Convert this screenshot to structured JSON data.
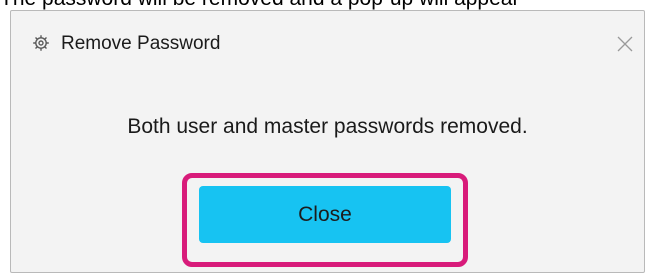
{
  "caption": {
    "text": "The password will be removed and a pop-up will appear"
  },
  "dialog": {
    "title": "Remove Password",
    "app_icon": "gear-app-icon",
    "close_icon": "close-icon",
    "message": "Both user and master passwords removed.",
    "close_button_label": "Close"
  },
  "colors": {
    "button_background": "#17c3f2",
    "highlight_border": "#d81b7a",
    "dialog_background": "#f3f3f3"
  }
}
